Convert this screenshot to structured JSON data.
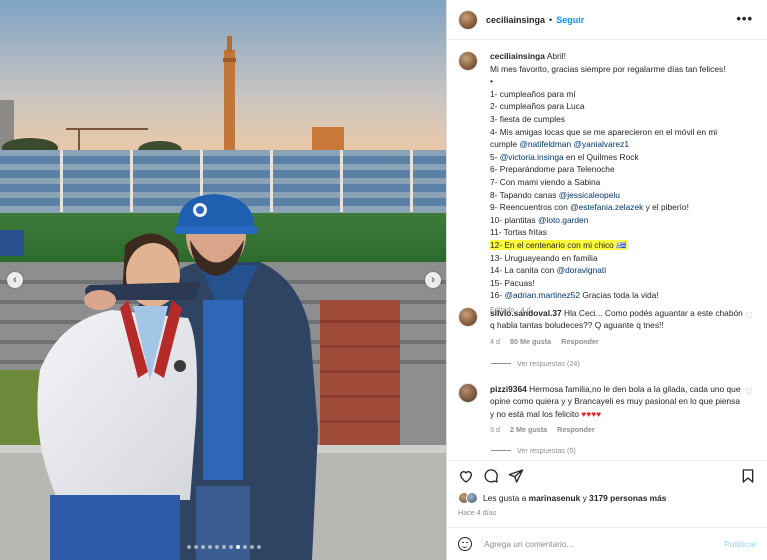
{
  "photo": {
    "description_icons": [
      "chevron-left-icon",
      "chevron-right-icon"
    ],
    "carousel_dots": 11,
    "carousel_active_index": 7
  },
  "header": {
    "username": "ceciliainsinga",
    "separator": "•",
    "follow_label": "Seguir",
    "more_label": "•••"
  },
  "caption": {
    "username": "ceciliainsinga",
    "intro": "Abril!",
    "line2": "Mi mes favorito, gracias siempre por regalarme días tan felices!",
    "bullet": "•",
    "items": {
      "i1": "1- cumpleaños para mí",
      "i2": "2- cumpleaños para Luca",
      "i3": "3- fiesta de cumples",
      "i4": "4- Mis amigas locas que se me aparecieron en el móvil en mi cumple",
      "i4_m1": "@natifeldman",
      "i4_m2": "@yanialvarez1",
      "i5": "5-",
      "i5_m": "@victoria.insinga",
      "i5_tail": "en el Quilmes Rock",
      "i6": "6- Preparándome para Telenoche",
      "i7": "7- Con mami viendo a Sabina",
      "i8": "8- Tapando canas",
      "i8_m": "@jessicaleopelu",
      "i9": "9- Reencuentros con",
      "i9_m": "@estefania.zelazek",
      "i9_tail": "y el piberío!",
      "i10": "10- plantitas",
      "i10_m": "@loto.garden",
      "i11": "11- Tortas fritas",
      "i12": "12- En el centenario con mi chico 🇺🇾",
      "i13": "13- Uruguayeando en familia",
      "i14": "14- La canita con",
      "i14_m": "@doravignati",
      "i15": "15- Pacuas!",
      "i16": "16-",
      "i16_m": "@adrian.martinez52",
      "i16_tail": "Gracias toda la vida!"
    },
    "meta": "Editado · 4 d"
  },
  "comments": [
    {
      "username": "silvio.sandoval.37",
      "text": "Hla Ceci... Como podés aguantar a este chabón q habla tantas boludeces?? Q aguante q tnes!!",
      "age": "4 d",
      "likes": "80 Me gusta",
      "reply": "Responder",
      "replies": "Ver respuestas (24)"
    },
    {
      "username": "pizzi9364",
      "text": "Hermosa familia,no le den bola a la gilada, cada uno que opine como quiera y y Brancayeli es muy pasional en lo que piensa y no está mal los felicito",
      "hearts": "♥♥♥♥",
      "age": "3 d",
      "likes": "2 Me gusta",
      "reply": "Responder",
      "replies": "Ver respuestas (5)"
    }
  ],
  "likes": {
    "prefix": "Les gusta a",
    "user": "marinasenuk",
    "connector": "y",
    "count": "3179 personas más"
  },
  "time_ago": "Hace 4 días",
  "add_comment": {
    "placeholder": "Agrega un comentario...",
    "post_label": "Publicar"
  },
  "colors": {
    "link": "#00376b",
    "follow": "#0095f6",
    "highlight": "#fbfb3c",
    "muted": "#8e8e8e"
  }
}
